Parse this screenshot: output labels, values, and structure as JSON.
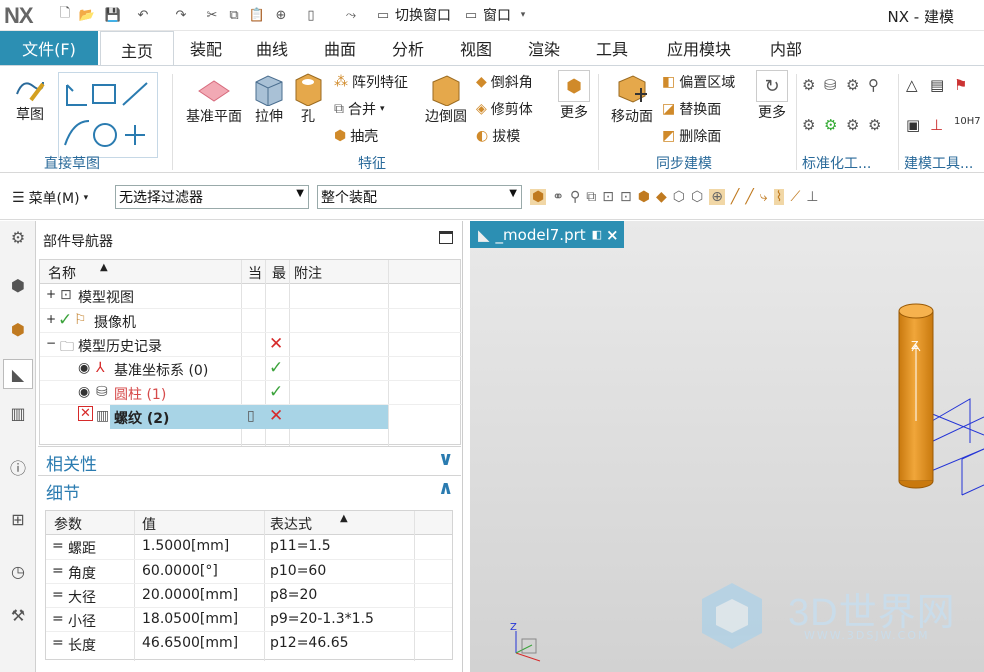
{
  "titlebar": {
    "logo": "NX",
    "switch_window": "切换窗口",
    "window_menu": "窗口",
    "app_title": "NX - 建模"
  },
  "tabs": [
    "文件(F)",
    "主页",
    "装配",
    "曲线",
    "曲面",
    "分析",
    "视图",
    "渲染",
    "工具",
    "应用模块",
    "内部"
  ],
  "ribbon": {
    "sketch": "草图",
    "direct_sketch": "直接草图",
    "datum_plane": "基准平面",
    "extrude": "拉伸",
    "hole": "孔",
    "pattern_feature": "阵列特征",
    "unite": "合并",
    "shell": "抽壳",
    "edge_blend": "边倒圆",
    "chamfer": "倒斜角",
    "trim_body": "修剪体",
    "draft": "拔模",
    "more": "更多",
    "feature_group": "特征",
    "move_face": "移动面",
    "offset_region": "偏置区域",
    "replace_face": "替换面",
    "delete_face": "删除面",
    "more2": "更多",
    "sync_group": "同步建模",
    "std_group": "标准化工...",
    "tools_group": "建模工具..."
  },
  "cmdbar": {
    "menu": "菜单(M)",
    "filter": "无选择过滤器",
    "scope": "整个装配"
  },
  "navigator": {
    "title": "部件导航器",
    "headers": [
      "名称",
      "当",
      "最",
      "附注"
    ],
    "rows": [
      {
        "label": "模型视图"
      },
      {
        "label": "摄像机"
      },
      {
        "label": "模型历史记录"
      },
      {
        "label": "基准坐标系 (0)"
      },
      {
        "label": "圆柱 (1)"
      },
      {
        "label": "螺纹 (2)"
      }
    ],
    "dependency": "相关性",
    "details": "细节",
    "detail_headers": [
      "参数",
      "值",
      "表达式"
    ],
    "details_rows": [
      {
        "param": "螺距",
        "value": "1.5000[mm]",
        "expr": "p11=1.5"
      },
      {
        "param": "角度",
        "value": "60.0000[°]",
        "expr": "p10=60"
      },
      {
        "param": "大径",
        "value": "20.0000[mm]",
        "expr": "p8=20"
      },
      {
        "param": "小径",
        "value": "18.0500[mm]",
        "expr": "p9=20-1.3*1.5"
      },
      {
        "param": "长度",
        "value": "46.6500[mm]",
        "expr": "p12=46.65"
      }
    ]
  },
  "viewport": {
    "tab": "_model7.prt",
    "axis_z": "Z",
    "watermark": "3D世界网",
    "watermark_url": "WWW.3DSJW.COM"
  },
  "colors": {
    "accent": "#2c8fb3",
    "cylinder": "#e89a1e",
    "selected_row": "#a8d4e6",
    "error": "#d62a2a",
    "ok": "#3ca33c"
  }
}
